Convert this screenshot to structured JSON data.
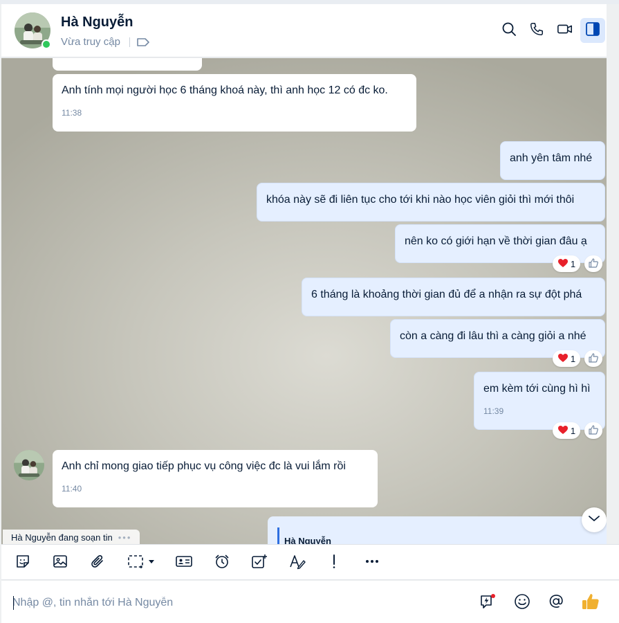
{
  "header": {
    "contact_name": "Hà Nguyễn",
    "status": "Vừa truy cập"
  },
  "messages": [
    {
      "side": "in",
      "text": "Anh tính mọi người học 6 tháng khoá này, thì anh học 12 có đc ko.",
      "time": "11:38"
    },
    {
      "side": "out",
      "text": "anh yên tâm nhé"
    },
    {
      "side": "out",
      "text": "khóa này sẽ đi liên tục cho tới khi nào học viên giỏi thì mới thôi"
    },
    {
      "side": "out",
      "text": "nên ko có giới hạn về thời gian đâu ạ",
      "reaction_count": "1"
    },
    {
      "side": "out",
      "text": "6 tháng là khoảng thời gian đủ để a nhận ra sự đột phá"
    },
    {
      "side": "out",
      "text": "còn a càng đi lâu thì a càng giỏi a nhé",
      "reaction_count": "1"
    },
    {
      "side": "out",
      "text": "em kèm tới cùng hì hì",
      "time": "11:39",
      "reaction_count": "1"
    },
    {
      "side": "in",
      "text": "Anh chỉ mong giao tiếp phục vụ công việc đc là vui lắm rồi",
      "time": "11:40"
    }
  ],
  "quote": {
    "name": "Hà Nguyễn"
  },
  "typing_indicator": "Hà Nguyễn đang soạn tin",
  "composer": {
    "placeholder": "Nhập @, tin nhắn tới Hà Nguyễn"
  },
  "toolbar_icons": [
    "sticker-icon",
    "image-icon",
    "attachment-icon",
    "screenshot-icon",
    "contact-card-icon",
    "reminder-icon",
    "todo-icon",
    "text-format-icon",
    "important-icon",
    "more-icon"
  ],
  "colors": {
    "accent": "#0068ff",
    "online": "#30c85c",
    "outgoing_bubble": "#e5efff",
    "like": "#f0b030"
  }
}
